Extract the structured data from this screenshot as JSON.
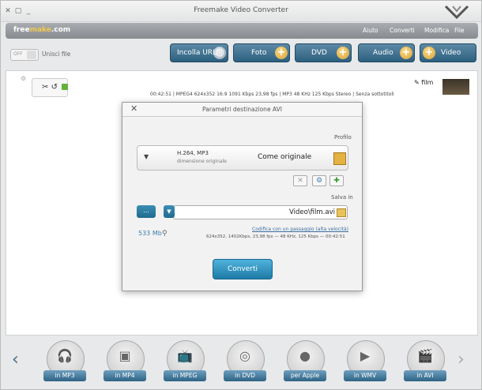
{
  "window": {
    "title": "Freemake Video Converter"
  },
  "menubar": {
    "brand_a": "free",
    "brand_b": "make",
    "brand_c": ".com",
    "items": [
      "File",
      "Modifica",
      "Converti",
      "Aiuto"
    ]
  },
  "toolbar": {
    "buttons": [
      "Video",
      "Audio",
      "DVD",
      "Foto",
      "Incolla URL"
    ]
  },
  "merge": {
    "label": "Unisci file",
    "state": "OFF"
  },
  "file": {
    "name": "film",
    "meta": "00:42:51 | MPEG4 624x352 16:9 1091 Kbps 23,98 fps | MP3 48 KHz 125 Kbps Stereo | Senza sottotitoli"
  },
  "dialog": {
    "title": "Parametri destinazione AVI",
    "profile_label": "Profilo",
    "profile_name": "Come originale",
    "profile_codec": "H.264, MP3",
    "profile_sub": "dimensione originale",
    "save_label": "Salva in",
    "save_path": "Video\\film.avi",
    "browse": "...",
    "encode_link": "Codifica con un passaggio (alta velocità)",
    "encode_info": "624x352, 1402Kbps, 23,98 fps — 48 KHz, 125 Kbps — 00:42:51",
    "size": "533 Mb",
    "convert": "Converti"
  },
  "formats": [
    "in AVI",
    "in WMV",
    "per Apple",
    "in DVD",
    "in MPEG",
    "in MP4",
    "in MP3"
  ]
}
